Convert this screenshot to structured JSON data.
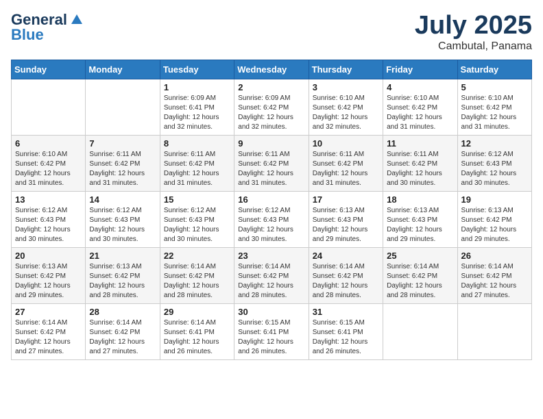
{
  "logo": {
    "general": "General",
    "blue": "Blue"
  },
  "title": {
    "month": "July 2025",
    "location": "Cambutal, Panama"
  },
  "weekdays": [
    "Sunday",
    "Monday",
    "Tuesday",
    "Wednesday",
    "Thursday",
    "Friday",
    "Saturday"
  ],
  "weeks": [
    [
      {
        "day": "",
        "info": ""
      },
      {
        "day": "",
        "info": ""
      },
      {
        "day": "1",
        "info": "Sunrise: 6:09 AM\nSunset: 6:41 PM\nDaylight: 12 hours and 32 minutes."
      },
      {
        "day": "2",
        "info": "Sunrise: 6:09 AM\nSunset: 6:42 PM\nDaylight: 12 hours and 32 minutes."
      },
      {
        "day": "3",
        "info": "Sunrise: 6:10 AM\nSunset: 6:42 PM\nDaylight: 12 hours and 32 minutes."
      },
      {
        "day": "4",
        "info": "Sunrise: 6:10 AM\nSunset: 6:42 PM\nDaylight: 12 hours and 31 minutes."
      },
      {
        "day": "5",
        "info": "Sunrise: 6:10 AM\nSunset: 6:42 PM\nDaylight: 12 hours and 31 minutes."
      }
    ],
    [
      {
        "day": "6",
        "info": "Sunrise: 6:10 AM\nSunset: 6:42 PM\nDaylight: 12 hours and 31 minutes."
      },
      {
        "day": "7",
        "info": "Sunrise: 6:11 AM\nSunset: 6:42 PM\nDaylight: 12 hours and 31 minutes."
      },
      {
        "day": "8",
        "info": "Sunrise: 6:11 AM\nSunset: 6:42 PM\nDaylight: 12 hours and 31 minutes."
      },
      {
        "day": "9",
        "info": "Sunrise: 6:11 AM\nSunset: 6:42 PM\nDaylight: 12 hours and 31 minutes."
      },
      {
        "day": "10",
        "info": "Sunrise: 6:11 AM\nSunset: 6:42 PM\nDaylight: 12 hours and 31 minutes."
      },
      {
        "day": "11",
        "info": "Sunrise: 6:11 AM\nSunset: 6:42 PM\nDaylight: 12 hours and 30 minutes."
      },
      {
        "day": "12",
        "info": "Sunrise: 6:12 AM\nSunset: 6:43 PM\nDaylight: 12 hours and 30 minutes."
      }
    ],
    [
      {
        "day": "13",
        "info": "Sunrise: 6:12 AM\nSunset: 6:43 PM\nDaylight: 12 hours and 30 minutes."
      },
      {
        "day": "14",
        "info": "Sunrise: 6:12 AM\nSunset: 6:43 PM\nDaylight: 12 hours and 30 minutes."
      },
      {
        "day": "15",
        "info": "Sunrise: 6:12 AM\nSunset: 6:43 PM\nDaylight: 12 hours and 30 minutes."
      },
      {
        "day": "16",
        "info": "Sunrise: 6:12 AM\nSunset: 6:43 PM\nDaylight: 12 hours and 30 minutes."
      },
      {
        "day": "17",
        "info": "Sunrise: 6:13 AM\nSunset: 6:43 PM\nDaylight: 12 hours and 29 minutes."
      },
      {
        "day": "18",
        "info": "Sunrise: 6:13 AM\nSunset: 6:43 PM\nDaylight: 12 hours and 29 minutes."
      },
      {
        "day": "19",
        "info": "Sunrise: 6:13 AM\nSunset: 6:42 PM\nDaylight: 12 hours and 29 minutes."
      }
    ],
    [
      {
        "day": "20",
        "info": "Sunrise: 6:13 AM\nSunset: 6:42 PM\nDaylight: 12 hours and 29 minutes."
      },
      {
        "day": "21",
        "info": "Sunrise: 6:13 AM\nSunset: 6:42 PM\nDaylight: 12 hours and 28 minutes."
      },
      {
        "day": "22",
        "info": "Sunrise: 6:14 AM\nSunset: 6:42 PM\nDaylight: 12 hours and 28 minutes."
      },
      {
        "day": "23",
        "info": "Sunrise: 6:14 AM\nSunset: 6:42 PM\nDaylight: 12 hours and 28 minutes."
      },
      {
        "day": "24",
        "info": "Sunrise: 6:14 AM\nSunset: 6:42 PM\nDaylight: 12 hours and 28 minutes."
      },
      {
        "day": "25",
        "info": "Sunrise: 6:14 AM\nSunset: 6:42 PM\nDaylight: 12 hours and 28 minutes."
      },
      {
        "day": "26",
        "info": "Sunrise: 6:14 AM\nSunset: 6:42 PM\nDaylight: 12 hours and 27 minutes."
      }
    ],
    [
      {
        "day": "27",
        "info": "Sunrise: 6:14 AM\nSunset: 6:42 PM\nDaylight: 12 hours and 27 minutes."
      },
      {
        "day": "28",
        "info": "Sunrise: 6:14 AM\nSunset: 6:42 PM\nDaylight: 12 hours and 27 minutes."
      },
      {
        "day": "29",
        "info": "Sunrise: 6:14 AM\nSunset: 6:41 PM\nDaylight: 12 hours and 26 minutes."
      },
      {
        "day": "30",
        "info": "Sunrise: 6:15 AM\nSunset: 6:41 PM\nDaylight: 12 hours and 26 minutes."
      },
      {
        "day": "31",
        "info": "Sunrise: 6:15 AM\nSunset: 6:41 PM\nDaylight: 12 hours and 26 minutes."
      },
      {
        "day": "",
        "info": ""
      },
      {
        "day": "",
        "info": ""
      }
    ]
  ]
}
